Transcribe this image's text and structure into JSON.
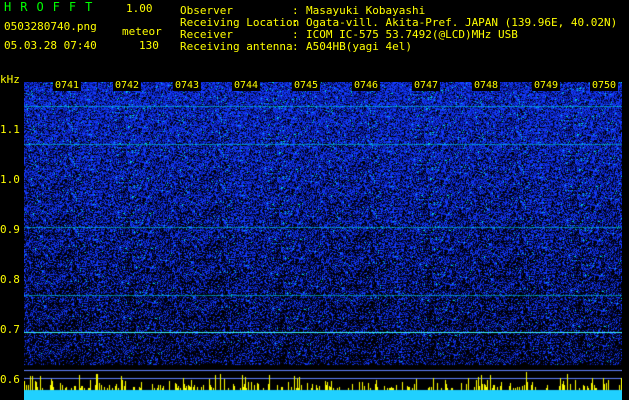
{
  "header": {
    "app_title": "HROFFT",
    "app_version": "1.00",
    "file_name": "0503280740.png",
    "mode": "meteor",
    "date_time": "05.03.28 07:40",
    "count": "130"
  },
  "info": [
    {
      "label": "Observer",
      "value": "Masayuki Kobayashi"
    },
    {
      "label": "Receiving Location",
      "value": "Ogata-vill. Akita-Pref. JAPAN (139.96E, 40.02N)"
    },
    {
      "label": "Receiver",
      "value": "ICOM IC-575 53.7492(@LCD)MHz USB"
    },
    {
      "label": "Receiving antenna",
      "value": "A504HB(yagi 4el)"
    }
  ],
  "y_axis": {
    "unit": "kHz",
    "ticks": [
      "1.1",
      "1.0",
      "0.9",
      "0.8",
      "0.7",
      "0.6"
    ]
  },
  "x_axis": {
    "ticks": [
      "0741",
      "0742",
      "0743",
      "0744",
      "0745",
      "0746",
      "0747",
      "0748",
      "0749",
      "0750"
    ]
  },
  "colors": {
    "background": "#000000",
    "text": "#ffff00",
    "title": "#00ff00",
    "noise_high": "#1a3fff",
    "noise_low": "#0a1a80",
    "signal": "#00e0e0",
    "meteor": "#ffff00"
  }
}
